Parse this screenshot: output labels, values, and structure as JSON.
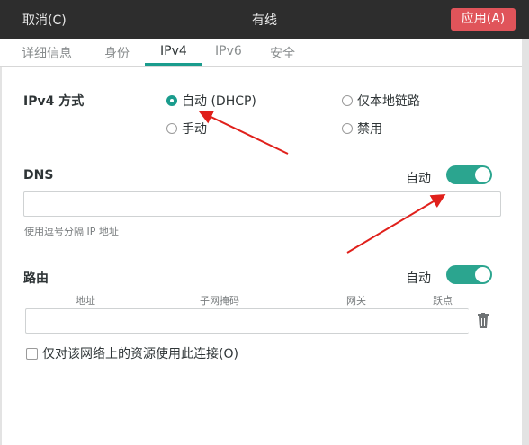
{
  "header": {
    "cancel_label": "取消(C)",
    "title": "有线",
    "apply_label": "应用(A)",
    "apply_color": "#e0545a"
  },
  "tabs": [
    {
      "label": "详细信息"
    },
    {
      "label": "身份"
    },
    {
      "label": "IPv4",
      "active": true
    },
    {
      "label": "IPv6"
    },
    {
      "label": "安全"
    }
  ],
  "ipv4": {
    "method_label": "IPv4 方式",
    "options": [
      {
        "label": "自动 (DHCP)",
        "checked": true
      },
      {
        "label": "仅本地链路",
        "checked": false
      },
      {
        "label": "手动",
        "checked": false
      },
      {
        "label": "禁用",
        "checked": false
      }
    ]
  },
  "dns": {
    "title": "DNS",
    "auto_label": "自动",
    "auto_on": true,
    "value": "",
    "hint": "使用逗号分隔 IP 地址"
  },
  "routes": {
    "title": "路由",
    "auto_label": "自动",
    "auto_on": true,
    "columns": [
      "地址",
      "子网掩码",
      "网关",
      "跃点"
    ]
  },
  "local_only": {
    "label": "仅对该网络上的资源使用此连接(O)",
    "checked": false
  },
  "colors": {
    "accent": "#1a9c8d",
    "switch_on": "#2ba58f",
    "annotation_arrow": "#e0201b"
  }
}
